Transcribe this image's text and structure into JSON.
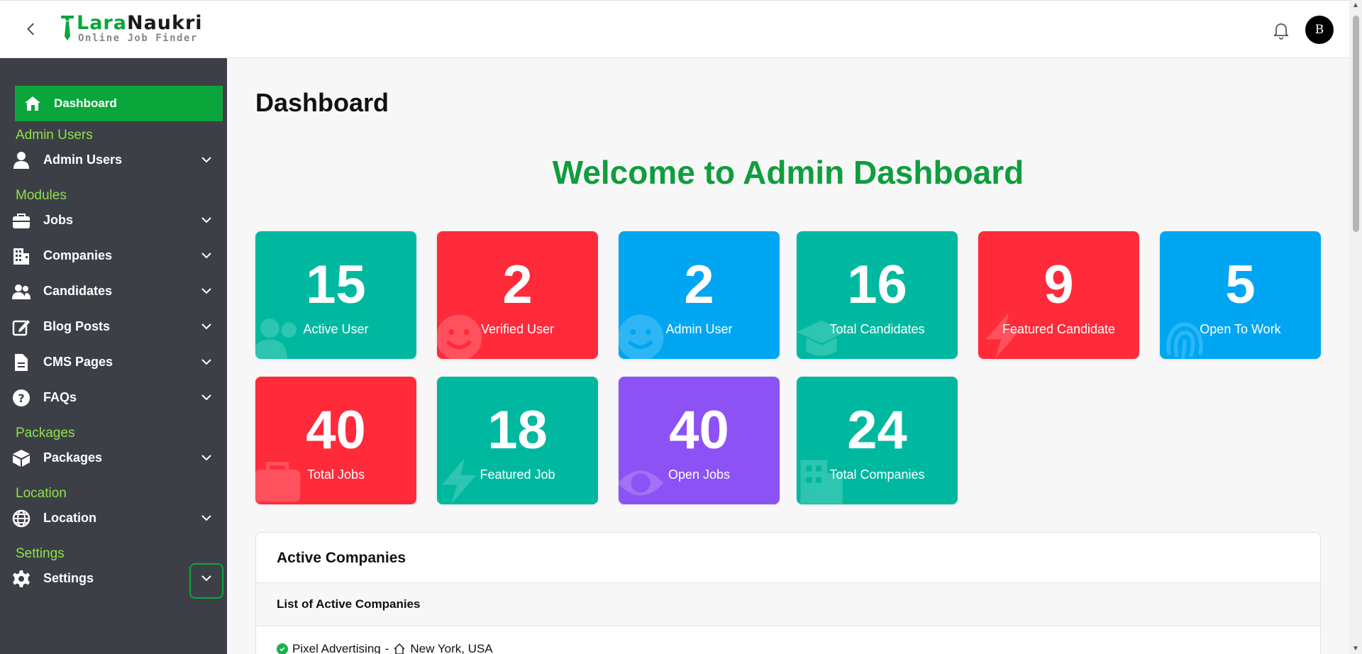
{
  "header": {
    "logo_lara": "Lara",
    "logo_naukri": "Naukri",
    "logo_tagline": "Online Job Finder",
    "avatar_initial": "B"
  },
  "sidebar": {
    "active_item": "Dashboard",
    "sections": {
      "admin_users": "Admin Users",
      "modules": "Modules",
      "packages": "Packages",
      "location": "Location",
      "settings": "Settings"
    },
    "items": {
      "admin_users": "Admin Users",
      "jobs": "Jobs",
      "companies": "Companies",
      "candidates": "Candidates",
      "blog_posts": "Blog Posts",
      "cms_pages": "CMS Pages",
      "faqs": "FAQs",
      "packages": "Packages",
      "location": "Location",
      "settings": "Settings"
    }
  },
  "main": {
    "page_title": "Dashboard",
    "welcome": "Welcome to Admin Dashboard",
    "stats": [
      {
        "value": "15",
        "label": "Active User",
        "color": "#00b8a0"
      },
      {
        "value": "2",
        "label": "Verified User",
        "color": "#ff2a3a"
      },
      {
        "value": "2",
        "label": "Admin User",
        "color": "#00a6f2"
      },
      {
        "value": "16",
        "label": "Total Candidates",
        "color": "#00b8a0"
      },
      {
        "value": "9",
        "label": "Featured Candidate",
        "color": "#ff2a3a"
      },
      {
        "value": "5",
        "label": "Open To Work",
        "color": "#00a6f2"
      },
      {
        "value": "40",
        "label": "Total Jobs",
        "color": "#ff2a3a"
      },
      {
        "value": "18",
        "label": "Featured Job",
        "color": "#00b8a0"
      },
      {
        "value": "40",
        "label": "Open Jobs",
        "color": "#8c52f5"
      },
      {
        "value": "24",
        "label": "Total Companies",
        "color": "#00b8a0"
      }
    ],
    "active_companies": {
      "title": "Active Companies",
      "subtitle": "List of Active Companies",
      "rows": [
        {
          "name": "Pixel Advertising",
          "separator": " - ",
          "location": "New York, USA"
        }
      ]
    }
  },
  "colors": {
    "brand_green": "#0aa63c",
    "sidebar_bg": "#3d3f47",
    "section_label": "#8ce34a"
  }
}
